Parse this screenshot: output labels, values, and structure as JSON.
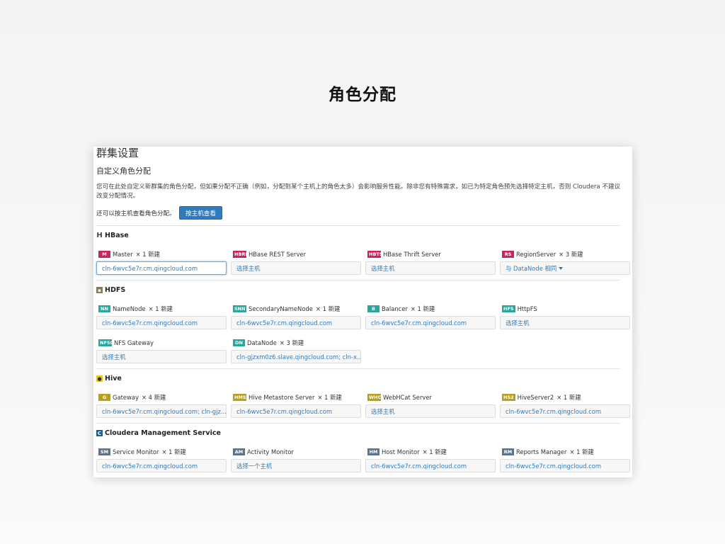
{
  "slide_title": "角色分配",
  "panel": {
    "title": "群集设置",
    "subtitle": "自定义角色分配",
    "description": "您可在此处自定义新群集的角色分配，但如果分配不正确（例如，分配到某个主机上的角色太多）会影响服务性能。除非您有特殊需求，如已为特定角色预先选择特定主机，否则 Cloudera 不建议改变分配情况。",
    "byhost_text": "还可以按主机查看角色分配。",
    "byhost_button": "按主机查看"
  },
  "colors": {
    "hbase_badge": "#c7265b",
    "hdfs_badge": "#2aa79c",
    "hive_badge": "#b8a019",
    "cm_badge": "#5f7488",
    "link": "#2f7bbd",
    "button": "#2f7bbd"
  },
  "services": [
    {
      "name": "HBase",
      "icon": "hbase-icon",
      "roles": [
        {
          "badge": "M",
          "name": "Master",
          "extra": "× 1 新建",
          "value": "cln-6wvc5e7r.cm.qingcloud.com",
          "focused": true
        },
        {
          "badge": "HBRE",
          "name": "HBase REST Server",
          "extra": "",
          "value": "选择主机"
        },
        {
          "badge": "HBTS",
          "name": "HBase Thrift Server",
          "extra": "",
          "value": "选择主机"
        },
        {
          "badge": "RS",
          "name": "RegionServer",
          "extra": "× 3 新建",
          "value": "与 DataNode 相同",
          "dropdown": true
        }
      ]
    },
    {
      "name": "HDFS",
      "icon": "hdfs-icon",
      "roles": [
        {
          "badge": "NN",
          "name": "NameNode",
          "extra": "× 1 新建",
          "value": "cln-6wvc5e7r.cm.qingcloud.com"
        },
        {
          "badge": "SNN",
          "name": "SecondaryNameNode",
          "extra": "× 1 新建",
          "value": "cln-6wvc5e7r.cm.qingcloud.com"
        },
        {
          "badge": "B",
          "name": "Balancer",
          "extra": "× 1 新建",
          "value": "cln-6wvc5e7r.cm.qingcloud.com"
        },
        {
          "badge": "HFS",
          "name": "HttpFS",
          "extra": "",
          "value": "选择主机"
        },
        {
          "badge": "NFSG",
          "name": "NFS Gateway",
          "extra": "",
          "value": "选择主机"
        },
        {
          "badge": "DN",
          "name": "DataNode",
          "extra": "× 3 新建",
          "value": "cln-gjzxm0z6.slave.qingcloud.com; cln-x..."
        }
      ]
    },
    {
      "name": "Hive",
      "icon": "hive-icon",
      "roles": [
        {
          "badge": "G",
          "name": "Gateway",
          "extra": "× 4 新建",
          "value": "cln-6wvc5e7r.cm.qingcloud.com; cln-gjz..."
        },
        {
          "badge": "HMS",
          "name": "Hive Metastore Server",
          "extra": "× 1 新建",
          "value": "cln-6wvc5e7r.cm.qingcloud.com"
        },
        {
          "badge": "WHC",
          "name": "WebHCat Server",
          "extra": "",
          "value": "选择主机"
        },
        {
          "badge": "HS2",
          "name": "HiveServer2",
          "extra": "× 1 新建",
          "value": "cln-6wvc5e7r.cm.qingcloud.com"
        }
      ]
    },
    {
      "name": "Cloudera Management Service",
      "icon": "cloudera-icon",
      "roles": [
        {
          "badge": "SM",
          "name": "Service Monitor",
          "extra": "× 1 新建",
          "value": "cln-6wvc5e7r.cm.qingcloud.com"
        },
        {
          "badge": "AM",
          "name": "Activity Monitor",
          "extra": "",
          "value": "选择一个主机"
        },
        {
          "badge": "HM",
          "name": "Host Monitor",
          "extra": "× 1 新建",
          "value": "cln-6wvc5e7r.cm.qingcloud.com"
        },
        {
          "badge": "RM",
          "name": "Reports Manager",
          "extra": "× 1 新建",
          "value": "cln-6wvc5e7r.cm.qingcloud.com"
        }
      ]
    }
  ]
}
